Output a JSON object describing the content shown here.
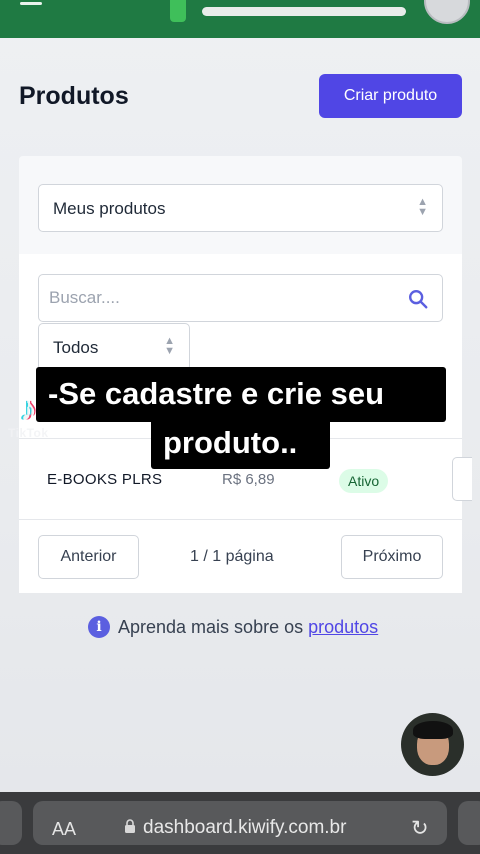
{
  "header": {
    "title": "Produtos",
    "create_button": "Criar produto"
  },
  "filters": {
    "product_scope": "Meus produtos",
    "search_placeholder": "Buscar....",
    "status_filter": "Todos"
  },
  "products": [
    {
      "name": "E-BOOKS PLRS",
      "price": "R$ 6,89",
      "status": "Ativo"
    }
  ],
  "pagination": {
    "prev_label": "Anterior",
    "info": "1 / 1 página",
    "next_label": "Próximo"
  },
  "learn_more": {
    "text": "Aprenda mais sobre os",
    "link": "produtos"
  },
  "caption": {
    "line1": "-Se cadastre e crie seu",
    "line2": "produto.."
  },
  "watermark": "TikTok",
  "browser": {
    "text_size_label": "AA",
    "url": "dashboard.kiwify.com.br"
  },
  "colors": {
    "accent": "#5046e5",
    "topbar": "#1f7a43",
    "status_active_bg": "#dcfce7"
  }
}
